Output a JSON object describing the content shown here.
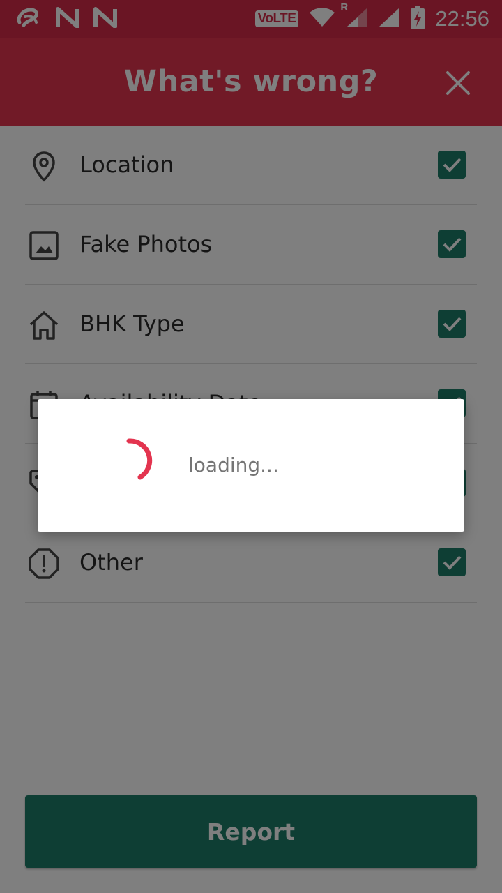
{
  "status_bar": {
    "time": "22:56",
    "volte": "VoLTE",
    "roaming": "R",
    "icons": [
      "carrier-logo-icon",
      "n-notification-icon",
      "n-notification-icon",
      "wifi-icon",
      "signal-icon",
      "signal-icon",
      "battery-charging-icon"
    ]
  },
  "header": {
    "title": "What's wrong?",
    "close_icon": "close-icon"
  },
  "items": [
    {
      "label": "Location",
      "icon": "location-pin-icon",
      "checked": true
    },
    {
      "label": "Fake Photos",
      "icon": "image-icon",
      "checked": true
    },
    {
      "label": "BHK Type",
      "icon": "home-icon",
      "checked": true
    },
    {
      "label": "Availability Date",
      "icon": "calendar-icon",
      "checked": true
    },
    {
      "label": "",
      "icon": "tag-icon",
      "checked": true
    },
    {
      "label": "Other",
      "icon": "alert-octagon-icon",
      "checked": true
    }
  ],
  "report_button": {
    "label": "Report"
  },
  "dialog": {
    "text": "loading..."
  },
  "colors": {
    "header": "#e3344f",
    "status_bar": "#d52b49",
    "accent": "#1d7c68",
    "spinner": "#e3344f"
  }
}
